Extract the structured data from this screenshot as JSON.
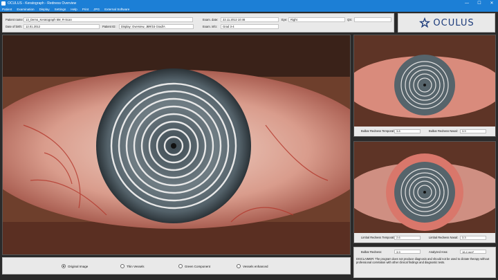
{
  "window": {
    "title": "OCULUS - Keratograph - Redness Overview",
    "controls": [
      "—",
      "☐",
      "✕"
    ]
  },
  "menu": [
    "Patient",
    "Examination",
    "Display",
    "Settings",
    "Help",
    "Print",
    "JPG",
    "External Software"
  ],
  "patient": {
    "name_label": "Patient name:",
    "name_value": "13_Demo_Keratograph 5M, R-Scan",
    "dob_label": "Date of birth:",
    "dob_value": "12.01.2012",
    "id_label": "Patient ID:",
    "id_value": "Display: Overview, JBR/15 Grad/A",
    "exam_date_label": "Exam. date:",
    "exam_date_value": "22.11.2012 10:46",
    "eye_label": "Eye:",
    "eye_value": "Right",
    "exam_info_label": "Exam. info:",
    "exam_info_value": "Grad 3-4",
    "qs_label": "QS:",
    "qs_value": ""
  },
  "logo": {
    "text": "OCULUS",
    "icon": "oculus-star-icon",
    "color": "#1b3a7a"
  },
  "bulbar": {
    "temporal_label": "Bulbar Redness Temporal:",
    "temporal_value": "3.8",
    "nasal_label": "Bulbar Redness Nasal:",
    "nasal_value": "3.9"
  },
  "limbal": {
    "temporal_label": "Limbal Redness Temporal:",
    "temporal_value": "2.6",
    "nasal_label": "Limbal Redness Nasal:",
    "nasal_value": "3.3"
  },
  "summary": {
    "bulbar_label": "Bulbar Redness:",
    "bulbar_value": "3.9",
    "area_label": "Analyzed Area:",
    "area_value": "16.4 mm²",
    "disclaimer": "DISCLAIMER: The program does not produce diagnosis and should not be used to dictate therapy without professional correlation with other clinical findings and diagnostic tests."
  },
  "modes": {
    "selected": "Original Image",
    "options": [
      "Original Image",
      "Thin Vessels",
      "Green Component",
      "Vessels enhanced"
    ]
  },
  "colors": {
    "accent": "#1c7fd6",
    "panel": "#e9e9e9"
  }
}
